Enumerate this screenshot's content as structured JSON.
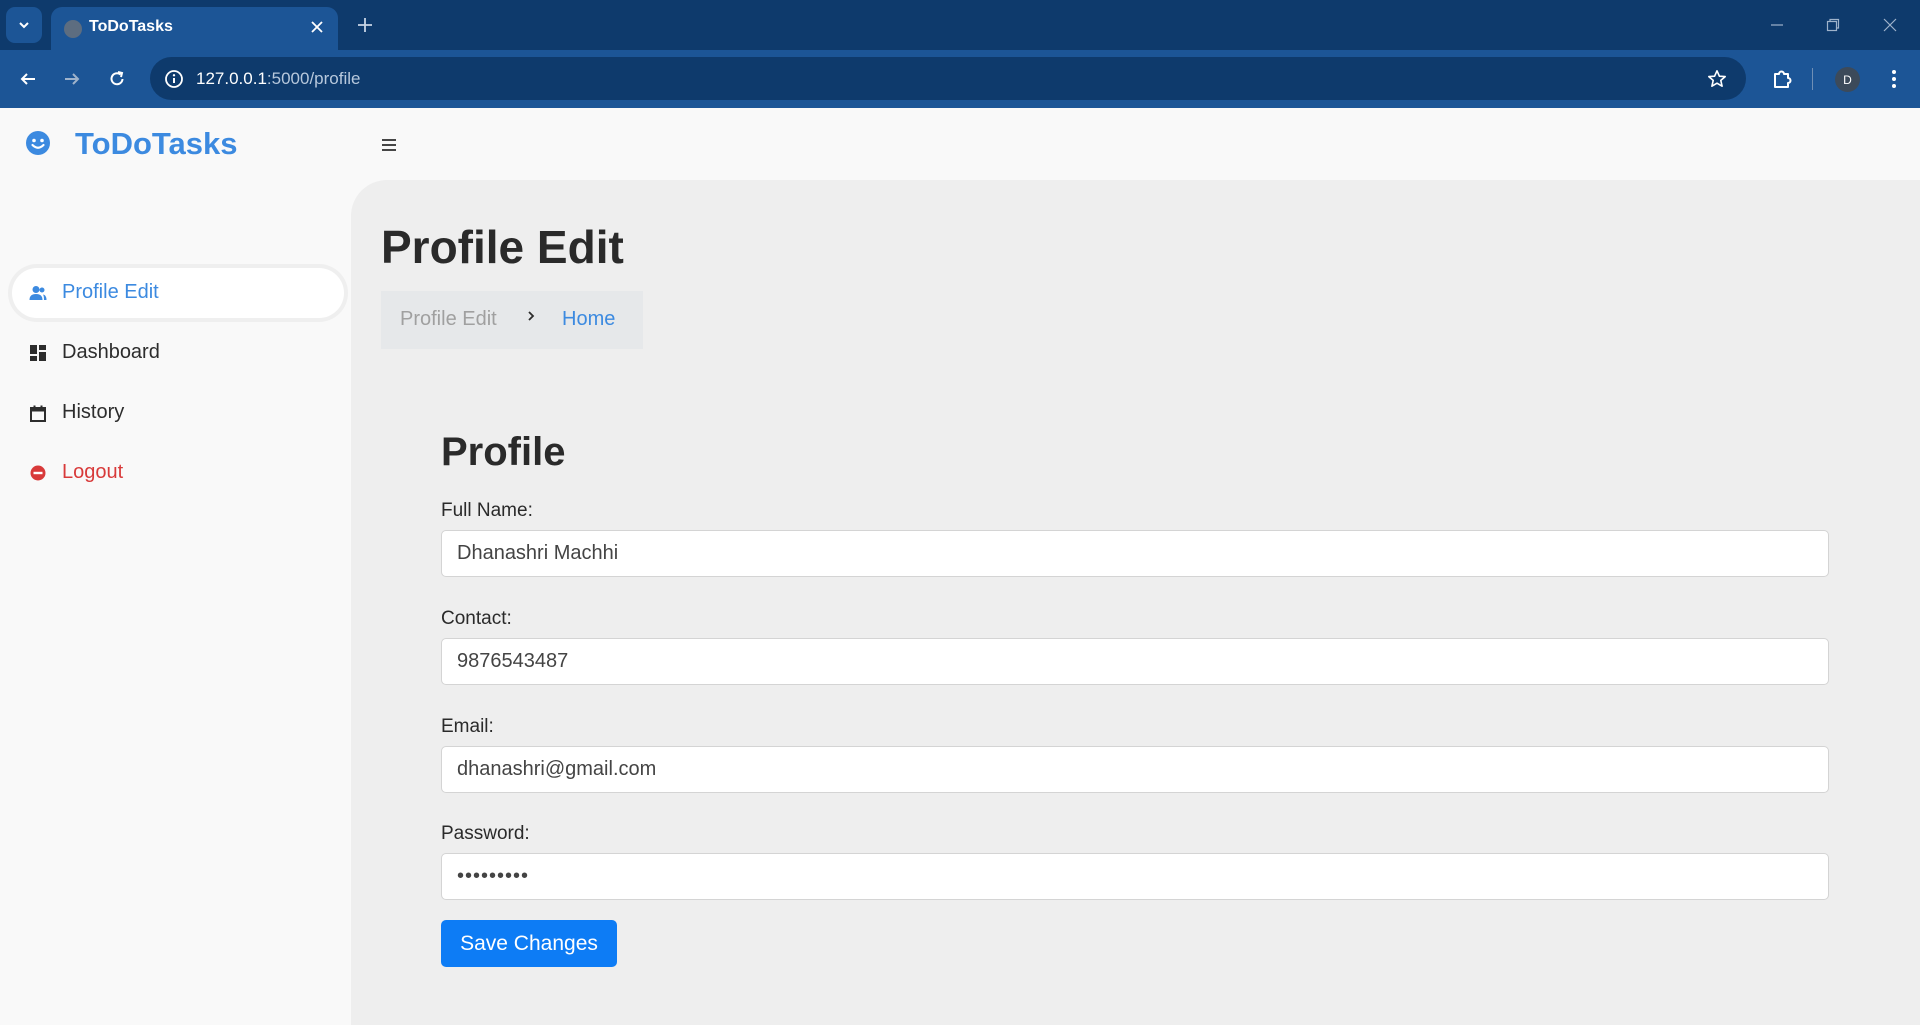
{
  "browser": {
    "tab_title": "ToDoTasks",
    "url_host": "127.0.0.1",
    "url_path": ":5000/profile",
    "profile_initial": "D"
  },
  "brand": {
    "name": "ToDoTasks",
    "color": "#3c8ae0"
  },
  "sidebar": {
    "items": [
      {
        "label": "Profile Edit",
        "icon": "user-icon",
        "active": true
      },
      {
        "label": "Dashboard",
        "icon": "dashboard-grid-icon",
        "active": false
      },
      {
        "label": "History",
        "icon": "calendar-icon",
        "active": false
      },
      {
        "label": "Logout",
        "icon": "minus-circle-icon",
        "active": false,
        "color": "#d83a3a"
      }
    ]
  },
  "header": {
    "title": "Profile Edit",
    "breadcrumb": {
      "current": "Profile Edit",
      "home": "Home"
    }
  },
  "form": {
    "title": "Profile",
    "full_name": {
      "label": "Full Name:",
      "value": "Dhanashri Machhi"
    },
    "contact": {
      "label": "Contact:",
      "value": "9876543487"
    },
    "email": {
      "label": "Email:",
      "value": "dhanashri@gmail.com"
    },
    "password": {
      "label": "Password:",
      "value": "•••••••••"
    },
    "save_label": "Save Changes"
  },
  "colors": {
    "accent": "#3c8ae0",
    "button": "#0d7cf5",
    "chrome_dark": "#0e3a6c",
    "chrome": "#1c5596"
  }
}
